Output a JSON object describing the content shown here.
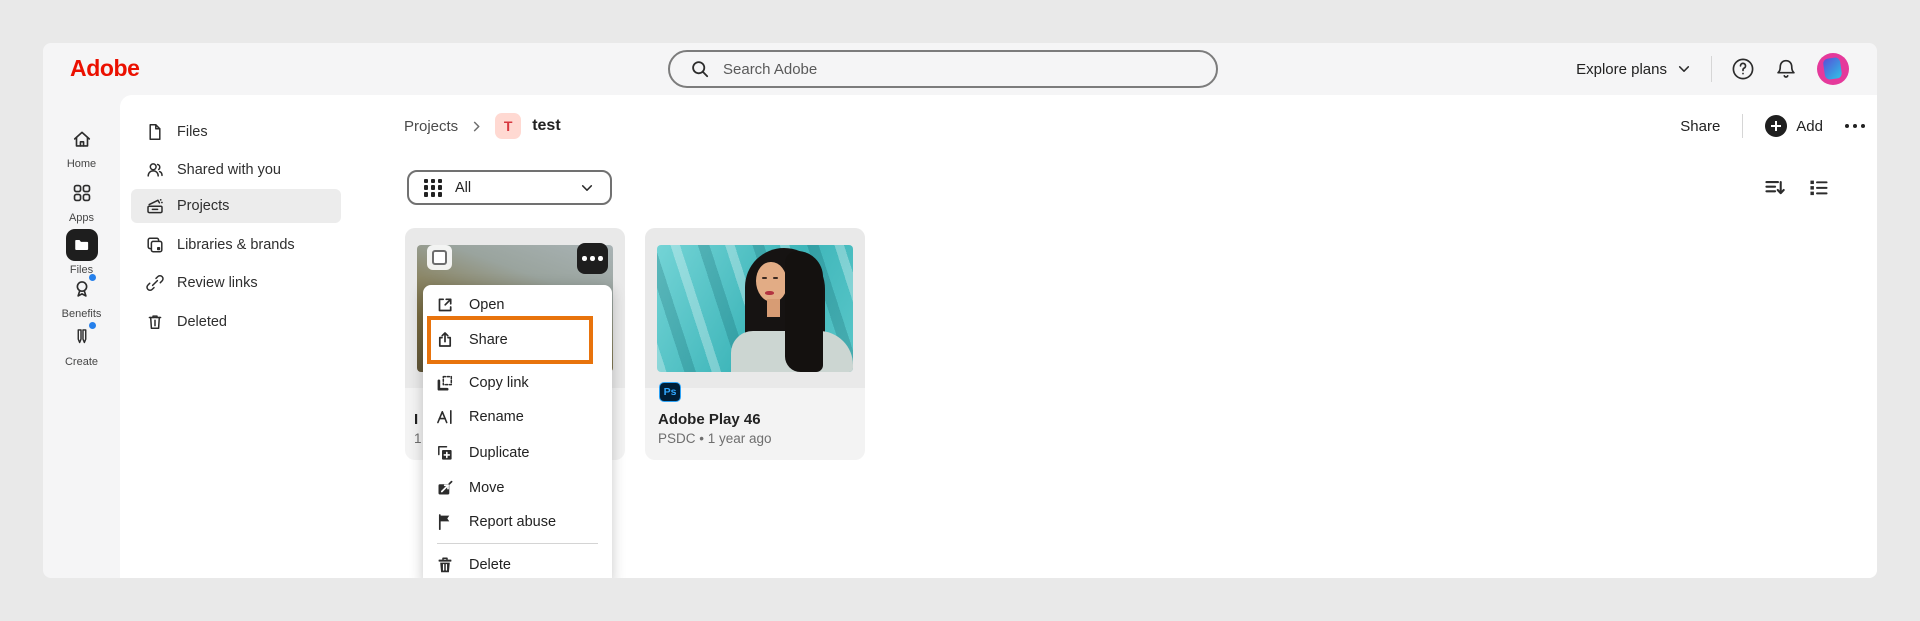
{
  "topbar": {
    "logo": "Adobe",
    "search_placeholder": "Search Adobe",
    "explore_label": "Explore plans"
  },
  "rail": {
    "items": [
      {
        "label": "Home",
        "icon": "home-icon",
        "active": false
      },
      {
        "label": "Apps",
        "icon": "apps-icon",
        "active": false
      },
      {
        "label": "Files",
        "icon": "folder-icon",
        "active": true
      },
      {
        "label": "Benefits",
        "icon": "benefits-icon",
        "active": false,
        "notification_dot": true
      },
      {
        "label": "Create",
        "icon": "create-icon",
        "active": false,
        "notification_dot": true
      }
    ]
  },
  "sidebar": {
    "items": [
      {
        "label": "Files",
        "icon": "document-icon",
        "active": false
      },
      {
        "label": "Shared with you",
        "icon": "people-icon",
        "active": false
      },
      {
        "label": "Projects",
        "icon": "projects-icon",
        "active": true
      },
      {
        "label": "Libraries & brands",
        "icon": "libraries-icon",
        "active": false
      },
      {
        "label": "Review links",
        "icon": "link-icon",
        "active": false
      },
      {
        "label": "Deleted",
        "icon": "trash-icon",
        "active": false
      }
    ]
  },
  "header": {
    "breadcrumb_root": "Projects",
    "project_initial": "T",
    "project_name": "test",
    "share_label": "Share",
    "add_label": "Add"
  },
  "toolbar": {
    "filter_label": "All"
  },
  "cards": [
    {
      "title_fragment": "I",
      "meta_fragment": "1"
    },
    {
      "badge": "Ps",
      "title": "Adobe Play 46",
      "meta": "PSDC • 1 year ago"
    }
  ],
  "context_menu": {
    "items": [
      {
        "label": "Open",
        "icon": "open-icon",
        "highlighted": false
      },
      {
        "label": "Share",
        "icon": "share-icon",
        "highlighted": true
      },
      {
        "label": "Copy link",
        "icon": "copy-link-icon",
        "highlighted": false
      },
      {
        "label": "Rename",
        "icon": "rename-icon",
        "highlighted": false
      },
      {
        "label": "Duplicate",
        "icon": "duplicate-icon",
        "highlighted": false
      },
      {
        "label": "Move",
        "icon": "move-icon",
        "highlighted": false
      },
      {
        "label": "Report abuse",
        "icon": "flag-icon",
        "highlighted": false
      },
      {
        "label": "Delete",
        "icon": "delete-icon",
        "divider_before": true,
        "highlighted": false
      }
    ]
  },
  "colors": {
    "adobe_red": "#EB1000",
    "highlight_orange": "#E8730C",
    "notification_blue": "#2680EB",
    "ps_badge_bg": "#001E36",
    "ps_badge_text": "#31A8FF",
    "project_badge_bg": "#FFD9D2",
    "project_badge_text": "#D7373F"
  }
}
